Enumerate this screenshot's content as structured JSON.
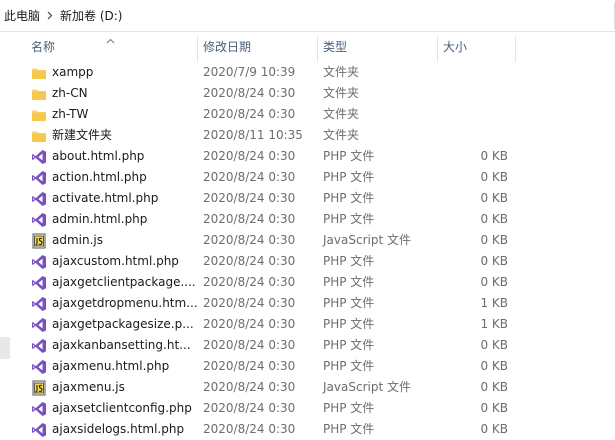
{
  "breadcrumb": {
    "root": "此电脑",
    "drive": "新加卷 (D:)"
  },
  "columns": {
    "name": "名称",
    "modified": "修改日期",
    "type": "类型",
    "size": "大小"
  },
  "colors": {
    "folder": "#f5c94c",
    "vs_purple": "#7b4fc4",
    "header_text": "#4c607a"
  },
  "files": [
    {
      "name": "xampp",
      "modified": "2020/7/9 10:39",
      "type": "文件夹",
      "size": "",
      "icon": "folder-icon"
    },
    {
      "name": "zh-CN",
      "modified": "2020/8/24 0:30",
      "type": "文件夹",
      "size": "",
      "icon": "folder-icon"
    },
    {
      "name": "zh-TW",
      "modified": "2020/8/24 0:30",
      "type": "文件夹",
      "size": "",
      "icon": "folder-icon"
    },
    {
      "name": "新建文件夹",
      "modified": "2020/8/11 10:35",
      "type": "文件夹",
      "size": "",
      "icon": "folder-icon"
    },
    {
      "name": "about.html.php",
      "modified": "2020/8/24 0:30",
      "type": "PHP 文件",
      "size": "0 KB",
      "icon": "visual-studio-icon"
    },
    {
      "name": "action.html.php",
      "modified": "2020/8/24 0:30",
      "type": "PHP 文件",
      "size": "0 KB",
      "icon": "visual-studio-icon"
    },
    {
      "name": "activate.html.php",
      "modified": "2020/8/24 0:30",
      "type": "PHP 文件",
      "size": "0 KB",
      "icon": "visual-studio-icon"
    },
    {
      "name": "admin.html.php",
      "modified": "2020/8/24 0:30",
      "type": "PHP 文件",
      "size": "0 KB",
      "icon": "visual-studio-icon"
    },
    {
      "name": "admin.js",
      "modified": "2020/8/24 0:30",
      "type": "JavaScript 文件",
      "size": "0 KB",
      "icon": "javascript-file-icon"
    },
    {
      "name": "ajaxcustom.html.php",
      "modified": "2020/8/24 0:30",
      "type": "PHP 文件",
      "size": "0 KB",
      "icon": "visual-studio-icon"
    },
    {
      "name": "ajaxgetclientpackage....",
      "modified": "2020/8/24 0:30",
      "type": "PHP 文件",
      "size": "0 KB",
      "icon": "visual-studio-icon"
    },
    {
      "name": "ajaxgetdropmenu.htm...",
      "modified": "2020/8/24 0:30",
      "type": "PHP 文件",
      "size": "1 KB",
      "icon": "visual-studio-icon"
    },
    {
      "name": "ajaxgetpackagesize.p...",
      "modified": "2020/8/24 0:30",
      "type": "PHP 文件",
      "size": "1 KB",
      "icon": "visual-studio-icon"
    },
    {
      "name": "ajaxkanbansetting.ht...",
      "modified": "2020/8/24 0:30",
      "type": "PHP 文件",
      "size": "0 KB",
      "icon": "visual-studio-icon"
    },
    {
      "name": "ajaxmenu.html.php",
      "modified": "2020/8/24 0:30",
      "type": "PHP 文件",
      "size": "0 KB",
      "icon": "visual-studio-icon"
    },
    {
      "name": "ajaxmenu.js",
      "modified": "2020/8/24 0:30",
      "type": "JavaScript 文件",
      "size": "0 KB",
      "icon": "javascript-file-icon"
    },
    {
      "name": "ajaxsetclientconfig.php",
      "modified": "2020/8/24 0:30",
      "type": "PHP 文件",
      "size": "0 KB",
      "icon": "visual-studio-icon"
    },
    {
      "name": "ajaxsidelogs.html.php",
      "modified": "2020/8/24 0:30",
      "type": "PHP 文件",
      "size": "0 KB",
      "icon": "visual-studio-icon"
    }
  ]
}
